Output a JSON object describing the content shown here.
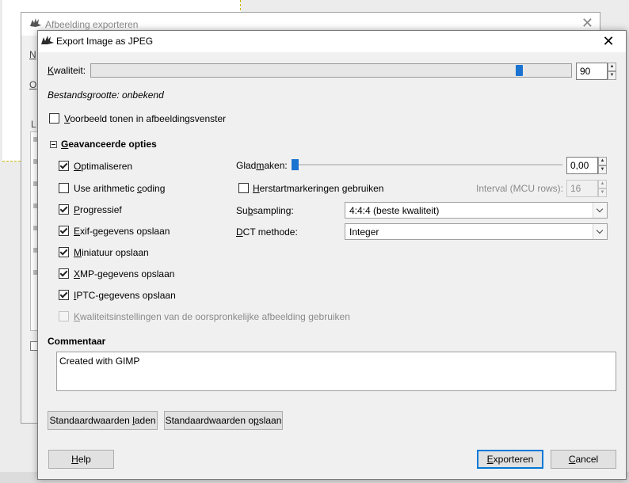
{
  "background": {
    "dialog_title": "Afbeelding exporteren",
    "fragments": [
      "N",
      "O",
      "L"
    ]
  },
  "window": {
    "title": "Export Image as JPEG",
    "close_glyph": "✕"
  },
  "quality": {
    "label_underlined": "K",
    "label_rest": "waliteit:",
    "value": "90",
    "slider_fraction": 0.9
  },
  "file_size": "Bestandsgrootte: onbekend",
  "preview": {
    "label_underlined": "V",
    "label_rest": "oorbeeld tonen in afbeeldingsvenster",
    "checked": false
  },
  "advanced": {
    "heading_underlined": "G",
    "heading_rest": "eavanceerde opties",
    "left_options": [
      {
        "pre": "",
        "u": "O",
        "post": "ptimaliseren",
        "checked": true,
        "disabled": false
      },
      {
        "pre": "Use arithmetic ",
        "u": "c",
        "post": "oding",
        "checked": false,
        "disabled": false
      },
      {
        "pre": "",
        "u": "P",
        "post": "rogressief",
        "checked": true,
        "disabled": false
      },
      {
        "pre": "",
        "u": "E",
        "post": "xif-gegevens opslaan",
        "checked": true,
        "disabled": false
      },
      {
        "pre": "",
        "u": "M",
        "post": "iniatuur opslaan",
        "checked": true,
        "disabled": false
      },
      {
        "pre": "",
        "u": "X",
        "post": "MP-gegevens opslaan",
        "checked": true,
        "disabled": false
      },
      {
        "pre": "",
        "u": "I",
        "post": "PTC-gegevens opslaan",
        "checked": true,
        "disabled": false
      },
      {
        "pre": "",
        "u": "K",
        "post": "waliteitsinstellingen van de oorspronkelijke afbeelding gebruiken",
        "checked": false,
        "disabled": true
      }
    ],
    "smoothing": {
      "pre": "Glad",
      "u": "m",
      "post": "aken:",
      "value": "0,00",
      "fraction": 0.0
    },
    "restart": {
      "pre": "",
      "u": "H",
      "post": "erstartmarkeringen gebruiken",
      "checked": false
    },
    "interval": {
      "label": "Interval (MCU rows):",
      "value": "16"
    },
    "subsampling": {
      "pre": "Su",
      "u": "b",
      "post": "sampling:",
      "value": "4:4:4 (beste kwaliteit)"
    },
    "dct": {
      "pre": "",
      "u": "D",
      "post": "CT methode:",
      "value": "Integer"
    }
  },
  "comment": {
    "heading": "Commentaar",
    "text": "Created with GIMP"
  },
  "buttons": {
    "load_defaults": {
      "pre": "Standaardwaarden ",
      "u": "l",
      "post": "aden"
    },
    "save_defaults": {
      "pre": "Standaardwaarden o",
      "u": "p",
      "post": "slaan"
    },
    "help": {
      "pre": "",
      "u": "H",
      "post": "elp"
    },
    "export": {
      "pre": "",
      "u": "E",
      "post": "xporteren"
    },
    "cancel": {
      "pre": "",
      "u": "C",
      "post": "ancel"
    }
  }
}
